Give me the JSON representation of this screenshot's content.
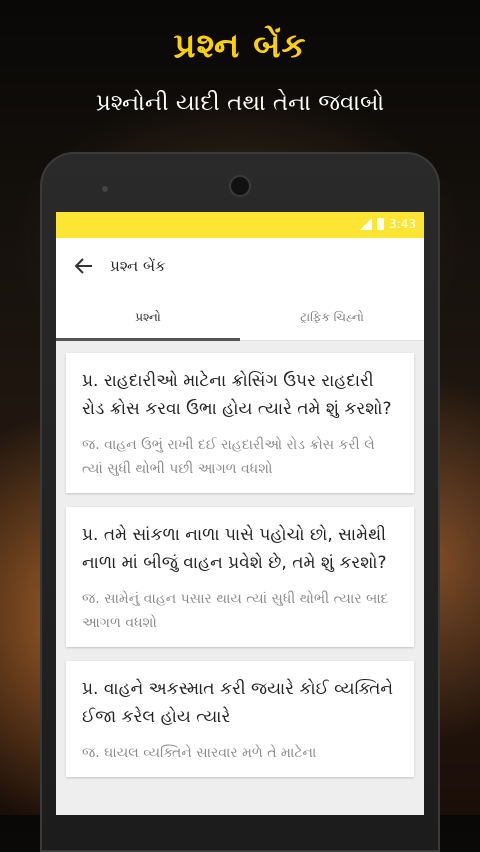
{
  "promo": {
    "title": "પ્રશ્ન બેંક",
    "subtitle": "પ્રશ્નોની યાદી તથા તેના જવાબો"
  },
  "status_bar": {
    "time": "3:43",
    "color": "#ffe533"
  },
  "app_bar": {
    "title": "પ્રશ્ન બેંક"
  },
  "tabs": [
    {
      "label": "પ્રશ્નો",
      "active": true
    },
    {
      "label": "ટ્રાફિક ચિહ્નો",
      "active": false
    }
  ],
  "questions": [
    {
      "question": "પ્ર. રાહદારીઓ માટેના ક્રોસિંગ ઉપર રાહદારી રોડ ક્રોસ કરવા ઉભા હોય ત્યારે તમે શું કરશો?",
      "answer": "જ. વાહન ઉભું રાખી દઈ રાહદારીઓ રોડ ક્રોસ કરી લે ત્યાં સુધી થોભી પછી આગળ વધશો"
    },
    {
      "question": "પ્ર. તમે સાંકળા નાળા પાસે પહોચો છો, સામેથી નાળા માં બીજું વાહન પ્રવેશે છે, તમે શું કરશો?",
      "answer": "જ. સામેનું વાહન પસાર થાય ત્યાં સુધી થોભી ત્યાર બાદ આગળ વધશો"
    },
    {
      "question": "પ્ર. વાહને અકસ્માત કરી જયારે કોઈ વ્યક્તિને ઈજા કરેલ હોય ત્યારે",
      "answer": "જ. ઘાયલ વ્યક્તિને સારવાર મળે તે માટેના"
    }
  ]
}
